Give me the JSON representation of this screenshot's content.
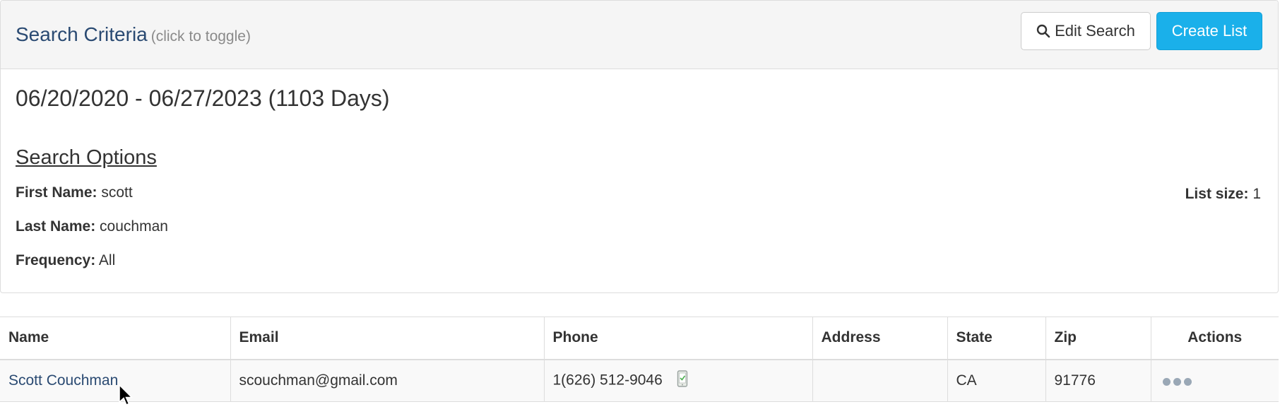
{
  "panel": {
    "title": "Search Criteria",
    "hint": "(click to toggle)",
    "edit_button": "Edit Search",
    "create_button": "Create List",
    "date_range": "06/20/2020 - 06/27/2023 (1103 Days)",
    "options_title": "Search Options",
    "options": [
      {
        "label": "First Name:",
        "value": "scott"
      },
      {
        "label": "Last Name:",
        "value": "couchman"
      },
      {
        "label": "Frequency:",
        "value": "All"
      }
    ],
    "list_size_label": "List size:",
    "list_size_value": "1"
  },
  "table": {
    "headers": [
      "Name",
      "Email",
      "Phone",
      "Address",
      "State",
      "Zip",
      "Actions"
    ],
    "rows": [
      {
        "name": "Scott Couchman",
        "email": "scouchman@gmail.com",
        "phone": "1(626) 512-9046",
        "address": "",
        "state": "CA",
        "zip": "91776"
      }
    ]
  },
  "icons": {
    "edit_button_icon": "search-icon",
    "phone_icon": "mobile-phone-check-icon",
    "actions_icon": "more-horizontal-icon"
  },
  "colors": {
    "title": "#2a4a72",
    "create_button": "#1ab0ea",
    "link": "#2a4a72"
  }
}
